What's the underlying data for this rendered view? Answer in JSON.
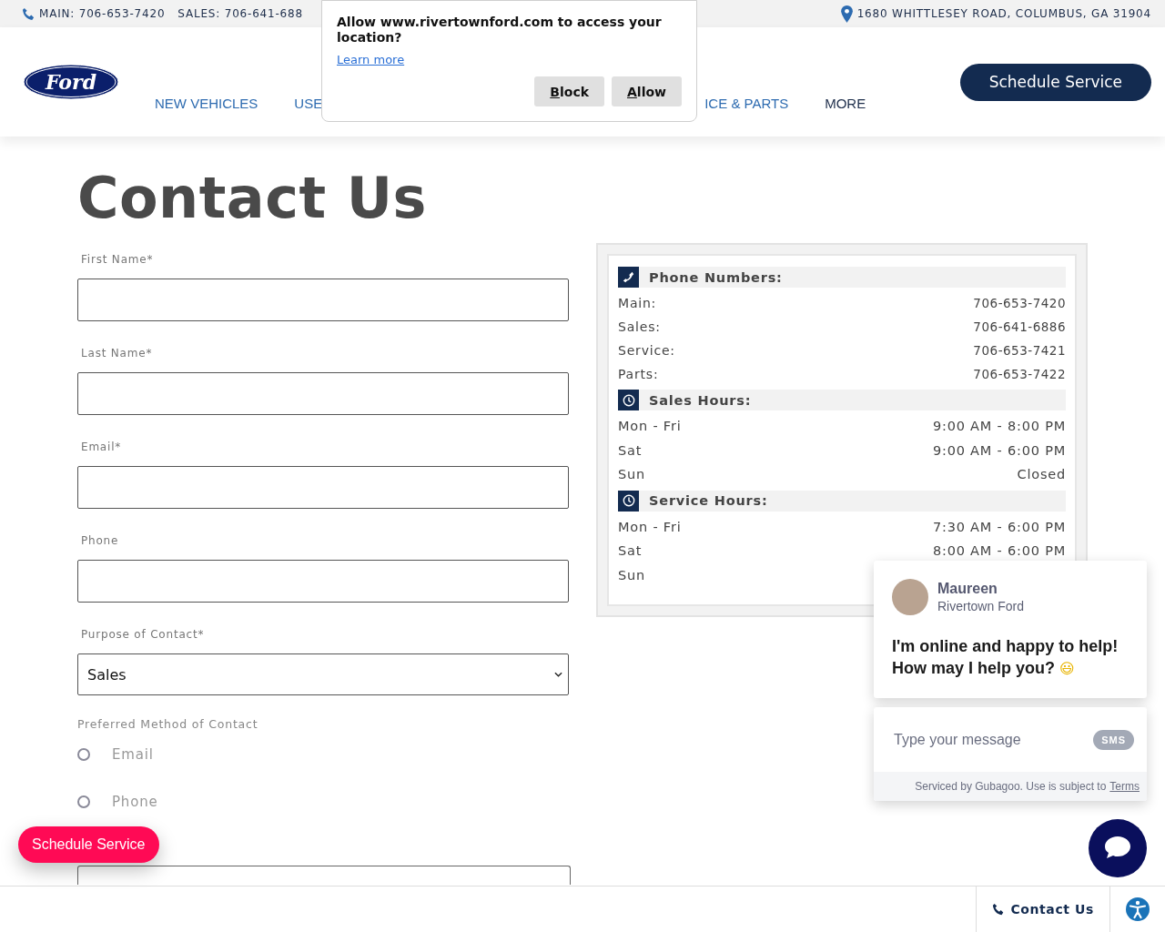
{
  "top_bar": {
    "phones": [
      "MAIN: 706-653-7420",
      "SALES: 706-641-688"
    ],
    "address": "1680 WHITTLESEY ROAD, COLUMBUS, GA 31904"
  },
  "header": {
    "logo_text": "Ford",
    "nav": [
      {
        "label": "NEW VEHICLES",
        "kind": "link"
      },
      {
        "label": "USE",
        "kind": "link"
      },
      {
        "label": "ICE & PARTS",
        "kind": "link"
      },
      {
        "label": "MORE",
        "kind": "more"
      }
    ],
    "cta": "Schedule Service"
  },
  "location_prompt": {
    "message": "Allow www.rivertownford.com to access your location?",
    "link": "Learn more",
    "buttons": [
      "Block",
      "Allow"
    ]
  },
  "page_title": "Contact Us",
  "form": {
    "fields": [
      {
        "label": "First Name*"
      },
      {
        "label": "Last Name*"
      },
      {
        "label": "Email*"
      },
      {
        "label": "Phone"
      }
    ],
    "purpose": {
      "label": "Purpose of Contact*",
      "value": "Sales"
    },
    "preferred": {
      "label": "Preferred Method of Contact",
      "options": [
        {
          "label": "Email",
          "selected": false
        },
        {
          "label": "Phone",
          "selected": false
        }
      ]
    }
  },
  "info_panel": {
    "sections": [
      {
        "kind": "phone",
        "title": "Phone Numbers:",
        "rows": [
          {
            "label": "Main:",
            "value": "706-653-7420"
          },
          {
            "label": "Sales:",
            "value": "706-641-6886"
          },
          {
            "label": "Service:",
            "value": "706-653-7421"
          },
          {
            "label": "Parts:",
            "value": "706-653-7422"
          }
        ]
      },
      {
        "kind": "clock",
        "title": "Sales Hours:",
        "rows": [
          {
            "label": "Mon - Fri",
            "value": "9:00 AM - 8:00 PM"
          },
          {
            "label": "Sat",
            "value": "9:00 AM - 6:00 PM"
          },
          {
            "label": "Sun",
            "value": "Closed"
          }
        ]
      },
      {
        "kind": "clock",
        "title": "Service Hours:",
        "rows": [
          {
            "label": "Mon - Fri",
            "value": "7:30 AM - 6:00 PM"
          },
          {
            "label": "Sat",
            "value": "8:00 AM - 6:00 PM"
          },
          {
            "label": "Sun"
          }
        ]
      }
    ]
  },
  "chat": {
    "agent": "Maureen",
    "dealer": "Rivertown Ford",
    "message": "I'm online and happy to help! How may I help you?",
    "emoji": "😃",
    "placeholder": "Type your message",
    "sms": "SMS",
    "footer": "Serviced by Gubagoo. Use is subject to",
    "footer_link": "Terms"
  },
  "floating_button": "Schedule Service",
  "bottom_bar": {
    "contact": "Contact Us"
  }
}
